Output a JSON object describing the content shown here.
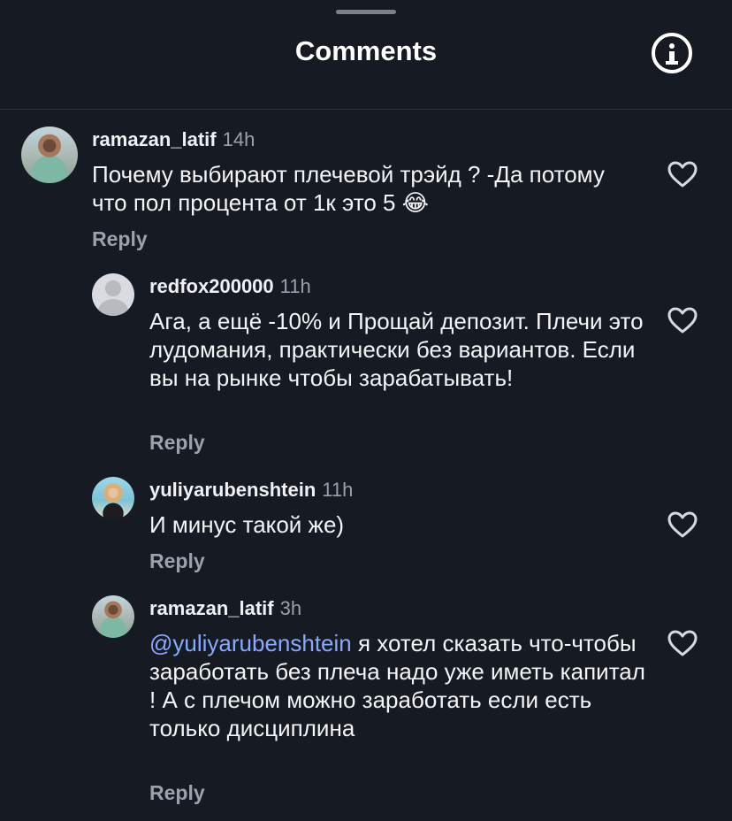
{
  "header": {
    "title": "Comments",
    "info_icon": "info-icon"
  },
  "comments": [
    {
      "username": "ramazan_latif",
      "time": "14h",
      "text": "Почему выбирают плечевой трэйд ? -Да потому что пол процента от 1к это 5 😂",
      "reply_label": "Reply"
    },
    {
      "username": "redfox200000",
      "time": "11h",
      "text": "Ага, а ещё -10% и Прощай депозит. Плечи это лудомания, практически без вариантов. Если вы на рынке чтобы зарабатывать!",
      "reply_label": "Reply"
    },
    {
      "username": "yuliyarubenshtein",
      "time": "11h",
      "text": "И минус такой же)",
      "reply_label": "Reply"
    },
    {
      "username": "ramazan_latif",
      "time": "3h",
      "mention": "@yuliyarubenshtein",
      "text": "я хотел сказать что-чтобы заработать без плеча надо уже иметь капитал ! А с плечом можно заработать если есть только дисциплина",
      "reply_label": "Reply"
    }
  ],
  "colors": {
    "background": "#161b23",
    "mention": "#8aa8ff",
    "secondary_text": "#9aa1ab"
  }
}
